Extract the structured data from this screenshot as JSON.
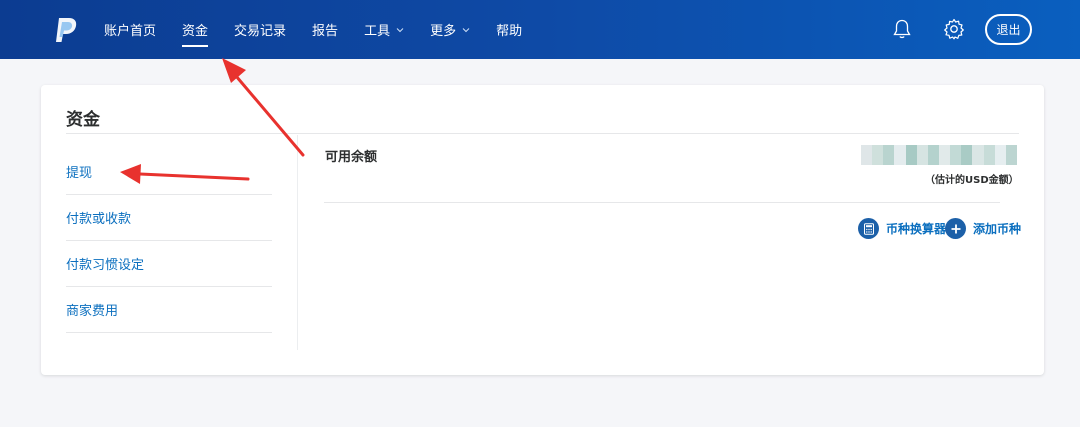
{
  "header": {
    "nav": [
      {
        "label": "账户首页",
        "active": false,
        "dropdown": false
      },
      {
        "label": "资金",
        "active": true,
        "dropdown": false
      },
      {
        "label": "交易记录",
        "active": false,
        "dropdown": false
      },
      {
        "label": "报告",
        "active": false,
        "dropdown": false
      },
      {
        "label": "工具",
        "active": false,
        "dropdown": true
      },
      {
        "label": "更多",
        "active": false,
        "dropdown": true
      },
      {
        "label": "帮助",
        "active": false,
        "dropdown": false
      }
    ],
    "icons": [
      "paypal-logo-icon",
      "bell-icon",
      "gear-icon"
    ],
    "logout_label": "退出"
  },
  "card": {
    "title": "资金",
    "sidebar": [
      {
        "label": "提现"
      },
      {
        "label": "付款或收款"
      },
      {
        "label": "付款习惯设定"
      },
      {
        "label": "商家费用"
      }
    ],
    "balance": {
      "label": "可用余额",
      "note": "（估计的USD金额）"
    },
    "actions": [
      {
        "label": "币种换算器",
        "icon": "calculator-icon"
      },
      {
        "label": "添加币种",
        "icon": "plus-icon"
      }
    ]
  },
  "colors": {
    "header_start": "#0c3c91",
    "header_end": "#0a5fbf",
    "link": "#0b6fbf",
    "annotation": "#e8322e"
  }
}
